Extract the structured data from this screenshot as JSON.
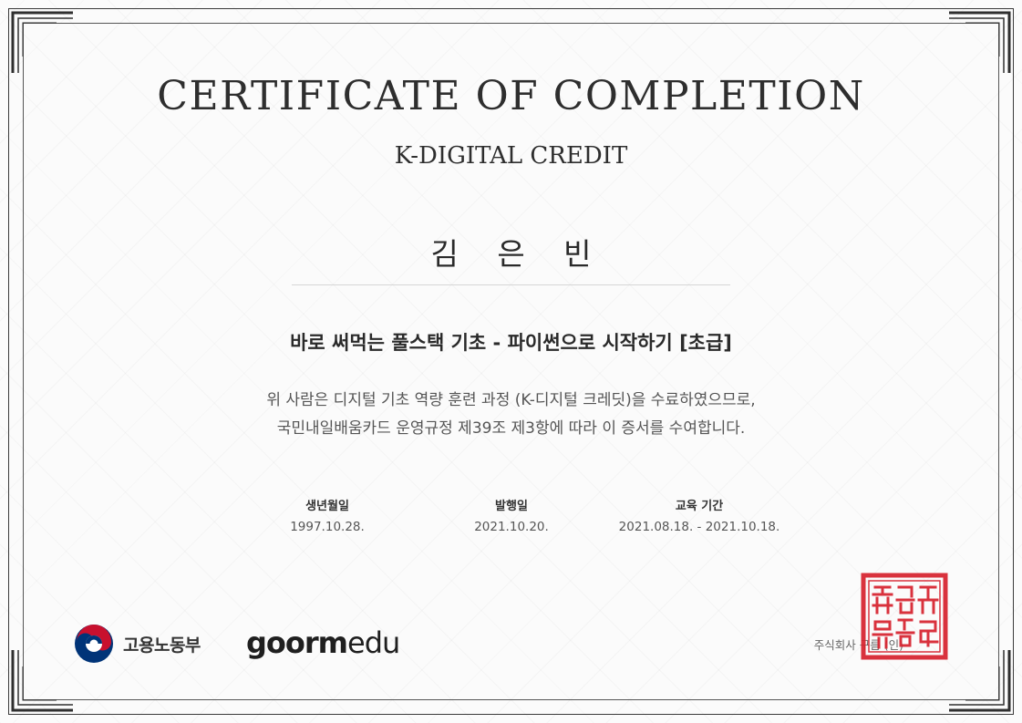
{
  "certificate": {
    "title": "CERTIFICATE OF COMPLETION",
    "subtitle": "K-DIGITAL CREDIT",
    "recipient_name": "김 은 빈",
    "course_name": "바로 써먹는 풀스택 기초 - 파이썬으로 시작하기 [초급]",
    "body_line1": "위 사람은 디지털 기초 역량 훈련 과정 (K-디지털 크레딧)을 수료하였으므로,",
    "body_line2": "국민내일배움카드 운영규정 제39조 제3항에 따라 이 증서를 수여합니다."
  },
  "details": {
    "birth_label": "생년월일",
    "birth_value": "1997.10.28.",
    "issue_label": "발행일",
    "issue_value": "2021.10.20.",
    "period_label": "교육 기간",
    "period_value": "2021.08.18. - 2021.10.18."
  },
  "footer": {
    "ministry_name": "고용노동부",
    "brand_goorm": "goorm",
    "brand_edu": "edu",
    "company_text": "주식회사 구름 (인)",
    "seal_text": "주식회사구름인"
  },
  "colors": {
    "seal_red": "#d7232f",
    "emblem_red": "#c8102e",
    "emblem_blue": "#003478",
    "frame": "#3a3a3a"
  },
  "icons": {
    "ministry_emblem": "taegeuk-emblem-icon",
    "company_seal": "red-seal-stamp"
  }
}
